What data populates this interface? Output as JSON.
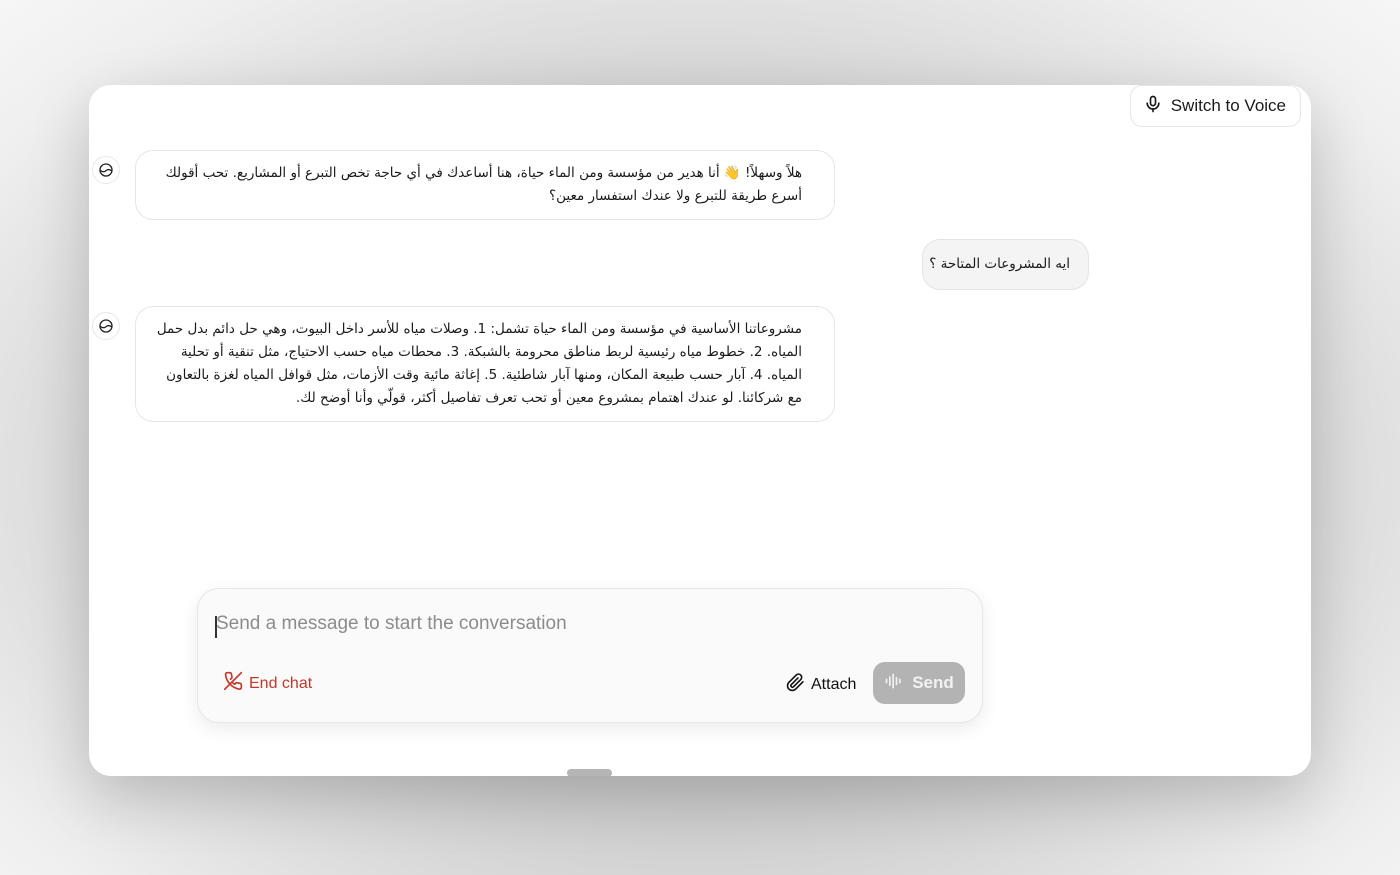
{
  "header": {
    "switch_voice_label": "Switch to Voice",
    "switch_voice_icon": "microphone-icon"
  },
  "messages": [
    {
      "role": "assistant",
      "avatar_icon": "bot-avatar-icon",
      "text": "هلاً وسهلاً! 👋 أنا هدير من مؤسسة ومن الماء حياة، هنا أساعدك في أي حاجة تخص التبرع أو المشاريع. تحب أقولك أسرع طريقة للتبرع ولا عندك استفسار معين؟"
    },
    {
      "role": "user",
      "text": "ايه المشروعات المتاحة ؟"
    },
    {
      "role": "assistant",
      "avatar_icon": "bot-avatar-icon",
      "text": "مشروعاتنا الأساسية في مؤسسة ومن الماء حياة تشمل: 1. وصلات مياه للأسر داخل البيوت، وهي حل دائم بدل حمل المياه. 2. خطوط مياه رئيسية لربط مناطق محرومة بالشبكة. 3. محطات مياه حسب الاحتياج، مثل تنقية أو تحلية المياه. 4. آبار حسب طبيعة المكان، ومنها آبار شاطئية. 5. إغاثة مائية وقت الأزمات، مثل قوافل المياه لغزة بالتعاون مع شركائنا. لو عندك اهتمام بمشروع معين أو تحب تعرف تفاصيل أكثر، قولّي وأنا أوضح لك."
    }
  ],
  "composer": {
    "placeholder": "Send a message to start the conversation",
    "value": "",
    "end_chat_label": "End chat",
    "end_chat_icon": "phone-off-icon",
    "attach_label": "Attach",
    "attach_icon": "paperclip-icon",
    "send_label": "Send",
    "send_icon": "audio-waveform-icon"
  },
  "colors": {
    "end_chat": "#c0392b",
    "send_disabled_bg": "#b3b3b3"
  }
}
